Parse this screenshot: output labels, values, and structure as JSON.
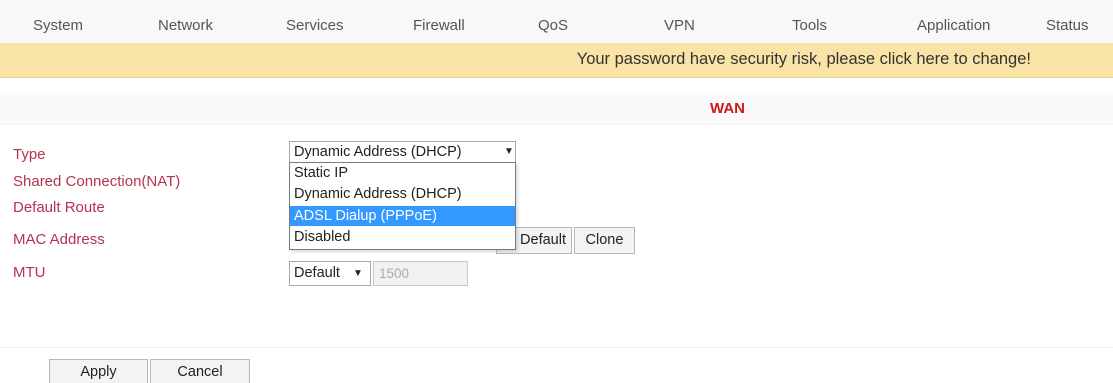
{
  "nav": {
    "items": [
      {
        "label": "System"
      },
      {
        "label": "Network"
      },
      {
        "label": "Services"
      },
      {
        "label": "Firewall"
      },
      {
        "label": "QoS"
      },
      {
        "label": "VPN"
      },
      {
        "label": "Tools"
      },
      {
        "label": "Application"
      },
      {
        "label": "Status"
      }
    ]
  },
  "banner": {
    "message": "Your password have security risk, please click here to change!"
  },
  "section": {
    "title": "WAN"
  },
  "form": {
    "type_label": "Type",
    "nat_label": "Shared Connection(NAT)",
    "route_label": "Default Route",
    "mac_label": "MAC Address",
    "mtu_label": "MTU",
    "type_select": {
      "selected": "Dynamic Address (DHCP)",
      "options": [
        "Static IP",
        "Dynamic Address (DHCP)",
        "ADSL Dialup (PPPoE)",
        "Disabled"
      ],
      "highlighted": "ADSL Dialup (PPPoE)"
    },
    "mac_default_button": "Default",
    "mac_clone_button": "Clone",
    "mtu_select": {
      "selected": "Default"
    },
    "mtu_value": "1500"
  },
  "actions": {
    "apply": "Apply",
    "cancel": "Cancel"
  },
  "colors": {
    "banner_bg": "#f9e3a6",
    "label_color": "#b5334f",
    "title_color": "#cc1a1a",
    "highlight": "#3398ff"
  }
}
